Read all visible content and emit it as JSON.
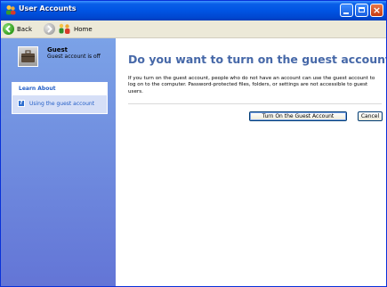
{
  "window": {
    "title": "User Accounts",
    "accent": "#0054e3"
  },
  "toolbar": {
    "back_label": "Back",
    "home_label": "Home"
  },
  "sidebar": {
    "user_name": "Guest",
    "user_status": "Guest account is off",
    "learn_about_header": "Learn About",
    "learn_items": [
      {
        "label": "Using the guest account",
        "icon": "help-topic-icon"
      }
    ]
  },
  "main": {
    "heading": "Do you want to turn on the guest account?",
    "description": "If you turn on the guest account, people who do not have an account can use the guest account to log on to the computer. Password-protected files, folders, or settings are not accessible to guest users.",
    "primary_button": "Turn On the Guest Account",
    "cancel_button": "Cancel"
  },
  "colors": {
    "heading": "#4668a8",
    "sidebar_top": "#7ba2e7",
    "sidebar_bottom": "#6375d6",
    "link": "#215dc6"
  }
}
